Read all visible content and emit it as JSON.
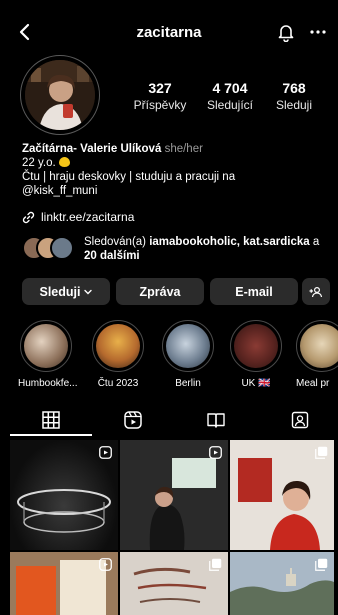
{
  "header": {
    "username": "zacitarna"
  },
  "stats": [
    {
      "value": "327",
      "label": "Příspěvky"
    },
    {
      "value": "4 704",
      "label": "Sledující"
    },
    {
      "value": "768",
      "label": "Sleduji"
    }
  ],
  "bio": {
    "name": "Začítárna- Valerie Ulíková",
    "pronouns": "she/her",
    "line1": "22 y.o.",
    "line2": "Čtu | hraju deskovky | studuju a pracuji na",
    "line3": "@kisk_ff_muni"
  },
  "link": "linktr.ee/zacitarna",
  "followed_by": {
    "prefix": "Sledován(a)",
    "names": "iamabookoholic, kat.sardicka",
    "middle": "a",
    "others": "20 dalšími"
  },
  "actions": {
    "follow": "Sleduji",
    "message": "Zpráva",
    "email": "E-mail"
  },
  "highlights": [
    {
      "label": "Humbookfe..."
    },
    {
      "label": "Čtu 2023"
    },
    {
      "label": "Berlin"
    },
    {
      "label": "UK 🇬🇧"
    },
    {
      "label": "Meal pr"
    }
  ],
  "colors": {
    "background": "#000000",
    "button": "#2b2b2b",
    "accent_emoji": "#f5c518"
  },
  "icons": {
    "back": "chevron-left-icon",
    "notifications": "bell-icon",
    "more": "more-horizontal-icon",
    "link": "link-icon",
    "add_person": "add-person-icon",
    "tab_posts": "grid-icon",
    "tab_reels": "reels-icon",
    "tab_guides": "guide-icon",
    "tab_tagged": "tagged-icon"
  }
}
